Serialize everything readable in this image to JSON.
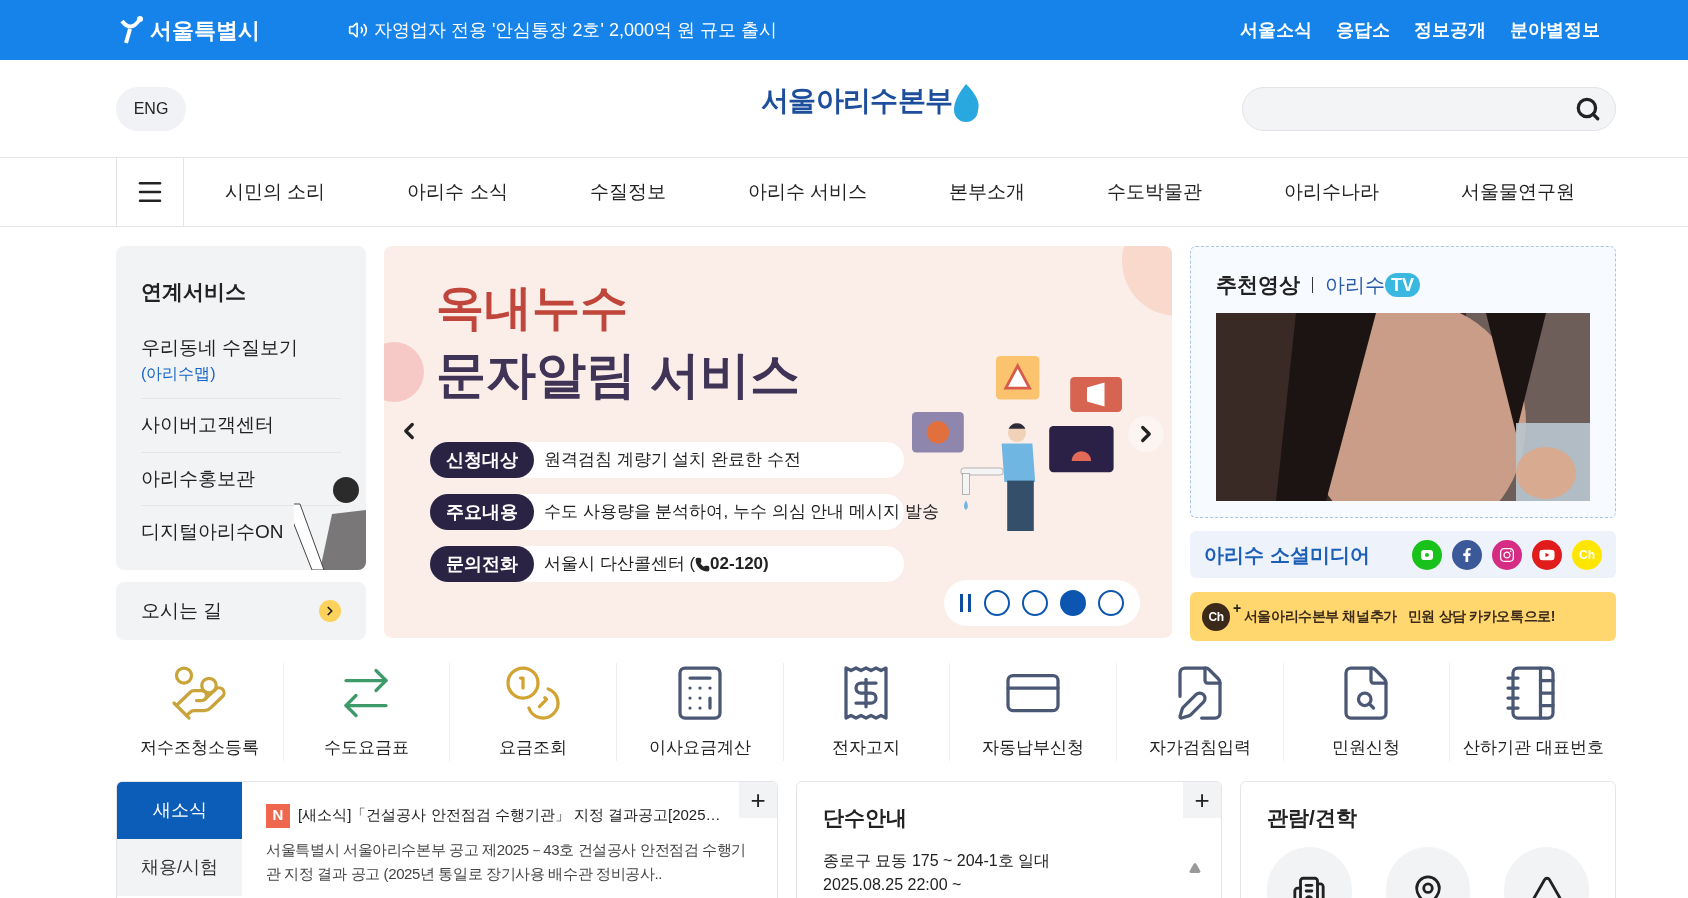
{
  "top_bar": {
    "logo_text": "서울특별시",
    "notice": "자영업자 전용 '안심통장 2호' 2,000억 원 규모 출시",
    "links": [
      "서울소식",
      "응답소",
      "정보공개",
      "분야별정보"
    ]
  },
  "header": {
    "lang_button": "ENG",
    "logo_text": "서울아리수본부"
  },
  "nav": {
    "items": [
      "시민의 소리",
      "아리수 소식",
      "수질정보",
      "아리수 서비스",
      "본부소개",
      "수도박물관",
      "아리수나라",
      "서울물연구원"
    ]
  },
  "linked_services": {
    "title": "연계서비스",
    "items": [
      {
        "label": "우리동네 수질보기",
        "sub": "(아리수맵)"
      },
      {
        "label": "사이버고객센터"
      },
      {
        "label": "아리수홍보관"
      },
      {
        "label": "디지털아리수ON"
      }
    ],
    "directions": "오시는 길"
  },
  "banner": {
    "title_line1": "옥내누수",
    "title_line2": "문자알림 서비스",
    "rows": [
      {
        "tag": "신청대상",
        "text": "원격검침 계량기 설치 완료한 수전"
      },
      {
        "tag": "주요내용",
        "text": "수도 사용량을 분석하여, 누수 의심 안내 메시지 발송"
      },
      {
        "tag": "문의전화",
        "text": "서울시 다산콜센터 (",
        "phone": "02-120)"
      }
    ],
    "dots": [
      {
        "selected": false
      },
      {
        "selected": false
      },
      {
        "selected": true
      },
      {
        "selected": false
      }
    ]
  },
  "video": {
    "title": "추천영상",
    "brand": "아리수",
    "brand_badge": "TV"
  },
  "social": {
    "title": "아리수 소셜미디어",
    "items": [
      {
        "kind": "blog"
      },
      {
        "kind": "facebook"
      },
      {
        "kind": "instagram"
      },
      {
        "kind": "youtube"
      },
      {
        "kind": "kakao",
        "glyph": "Ch"
      }
    ]
  },
  "kakao": {
    "badge": "Ch",
    "plus": "+",
    "text": "서울아리수본부 채널추가",
    "text2": "민원 상담 카카오톡으로!"
  },
  "quick_links": [
    {
      "kind": "hand",
      "label": "저수조청소등록"
    },
    {
      "kind": "exchange",
      "label": "수도요금표"
    },
    {
      "kind": "coins",
      "label": "요금조회"
    },
    {
      "kind": "calculator",
      "label": "이사요금계산"
    },
    {
      "kind": "bill",
      "label": "전자고지"
    },
    {
      "kind": "card",
      "label": "자동납부신청"
    },
    {
      "kind": "form",
      "label": "자가검침입력"
    },
    {
      "kind": "search",
      "label": "민원신청"
    },
    {
      "kind": "notebook",
      "label": "산하기관 대표번호"
    }
  ],
  "news": {
    "tabs": [
      {
        "label": "새소식",
        "selected": true
      },
      {
        "label": "채용/시험",
        "selected": false
      }
    ],
    "badge": "N",
    "title": "[새소식]「건설공사 안전점검 수행기관」 지정 결과공고[2025…",
    "body": "서울특별시 서울아리수본부 공고 제2025－43호  건설공사 안전점검 수행기관 지정 결과 공고 (2025년 통일로 장기사용 배수관 정비공사..",
    "more": "+"
  },
  "outage": {
    "title": "단수안내",
    "more": "+",
    "lines": [
      "종로구 묘동 175 ~ 204-1호 일대",
      "2025.08.25 22:00 ~"
    ]
  },
  "tour": {
    "title": "관람/견학"
  }
}
